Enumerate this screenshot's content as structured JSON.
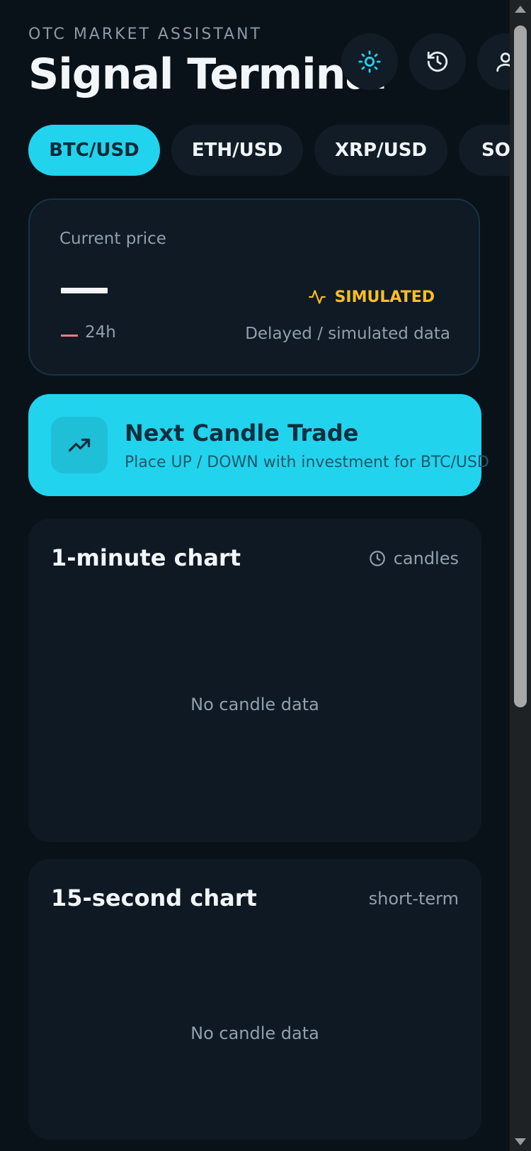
{
  "header": {
    "eyebrow": "OTC MARKET ASSISTANT",
    "title": "Signal Terminal",
    "icons": [
      "sun-icon",
      "history-icon",
      "user-icon"
    ]
  },
  "pairs": [
    {
      "label": "BTC/USD",
      "active": true
    },
    {
      "label": "ETH/USD",
      "active": false
    },
    {
      "label": "XRP/USD",
      "active": false
    },
    {
      "label": "SOL",
      "active": false
    }
  ],
  "price_card": {
    "label": "Current price",
    "value": "—",
    "change_period": "24h",
    "badge": "SIMULATED",
    "note": "Delayed / simulated data"
  },
  "trade": {
    "title": "Next Candle Trade",
    "subtitle": "Place UP / DOWN with investment for BTC/USD"
  },
  "charts": [
    {
      "title": "1-minute chart",
      "meta": "candles",
      "empty": "No candle data"
    },
    {
      "title": "15-second chart",
      "meta": "short-term",
      "empty": "No candle data"
    }
  ],
  "colors": {
    "accent": "#22d3ee",
    "warning": "#fbbf24",
    "negative": "#f07a86",
    "background": "#0a1219",
    "card": "#0f1a24"
  }
}
